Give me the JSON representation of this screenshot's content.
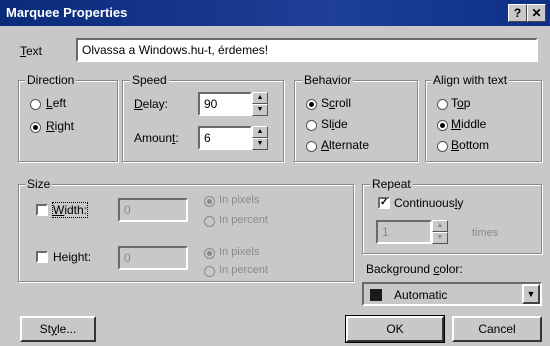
{
  "window": {
    "title": "Marquee Properties",
    "help_glyph": "?",
    "close_glyph": "✕"
  },
  "text": {
    "label": "Text",
    "value": "Olvassa a Windows.hu-t, érdemes!"
  },
  "direction": {
    "title": "Direction",
    "options": [
      {
        "label": "Left",
        "selected": false
      },
      {
        "label": "Right",
        "selected": true
      }
    ]
  },
  "speed": {
    "title": "Speed",
    "delay_label": "Delay:",
    "delay_value": "90",
    "amount_label": "Amount:",
    "amount_value": "6"
  },
  "behavior": {
    "title": "Behavior",
    "options": [
      {
        "label": "Scroll",
        "selected": true
      },
      {
        "label": "Slide",
        "selected": false
      },
      {
        "label": "Alternate",
        "selected": false
      }
    ]
  },
  "align": {
    "title": "Align with text",
    "options": [
      {
        "label": "Top",
        "selected": false
      },
      {
        "label": "Middle",
        "selected": true
      },
      {
        "label": "Bottom",
        "selected": false
      }
    ]
  },
  "size": {
    "title": "Size",
    "width_label": "Width:",
    "width_checked": false,
    "width_value": "0",
    "height_label": "Height:",
    "height_checked": false,
    "height_value": "0",
    "in_pixels": "In pixels",
    "in_percent": "In percent"
  },
  "repeat": {
    "title": "Repeat",
    "continuously_label": "Continuously",
    "continuously_checked": true,
    "times_value": "1",
    "times_label": "times"
  },
  "background": {
    "label": "Background color:",
    "value": "Automatic",
    "swatch_color": "#1a1a1a"
  },
  "buttons": {
    "style": "Style...",
    "ok": "OK",
    "cancel": "Cancel"
  }
}
